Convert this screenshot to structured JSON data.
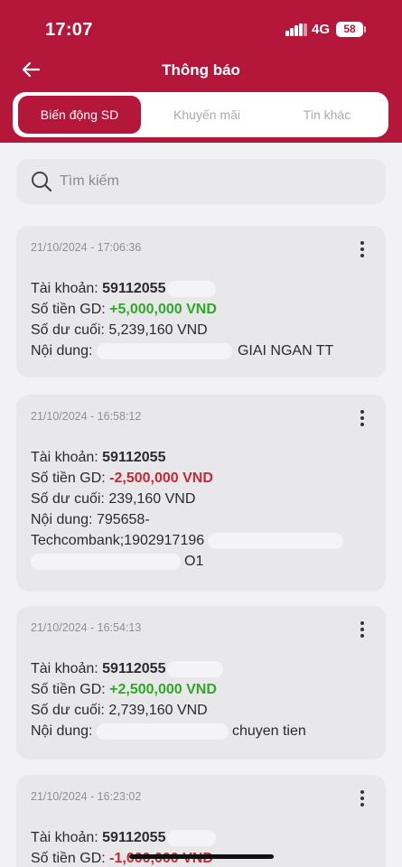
{
  "status_bar": {
    "time": "17:07",
    "network": "4G",
    "battery": "58"
  },
  "header": {
    "title": "Thông báo"
  },
  "tabs": [
    {
      "label": "Biến động SD",
      "active": true
    },
    {
      "label": "Khuyến mãi",
      "active": false
    },
    {
      "label": "Tin khác",
      "active": false
    }
  ],
  "search": {
    "placeholder": "Tìm kiếm"
  },
  "notifications": [
    {
      "datetime": "21/10/2024 - 17:06:36",
      "account_label": "Tài khoản: ",
      "account": "59112055",
      "amount_label": "Số tiền GD: ",
      "amount": "+5,000,000 VND",
      "balance": "Số dư cuối: 5,239,160 VND",
      "content_label": "Nội dung: ",
      "content_tail": "GIAI NGAN TT"
    },
    {
      "datetime": "21/10/2024 - 16:58:12",
      "account_label": "Tài khoản: ",
      "account": "59112055",
      "amount_label": "Số tiền GD: ",
      "amount": "-2,500,000 VND",
      "balance": "Số dư cuối: 239,160 VND",
      "content_label": "Nội dung: ",
      "content_line1": "795658-",
      "content_line2": "Techcombank;1902917196",
      "content_tail": "O1"
    },
    {
      "datetime": "21/10/2024 - 16:54:13",
      "account_label": "Tài khoản: ",
      "account": "59112055",
      "amount_label": "Số tiền GD: ",
      "amount": "+2,500,000 VND",
      "balance": "Số dư cuối: 2,739,160 VND",
      "content_label": "Nội dung: ",
      "content_tail": "chuyen tien"
    },
    {
      "datetime": "21/10/2024 - 16:23:02",
      "account_label": "Tài khoản: ",
      "account": "59112055",
      "amount_label": "Số tiền GD: ",
      "amount": "-1,000,000 VND"
    }
  ],
  "colors": {
    "brand": "#b5173b",
    "positive": "#2ea826",
    "negative": "#c42935"
  }
}
